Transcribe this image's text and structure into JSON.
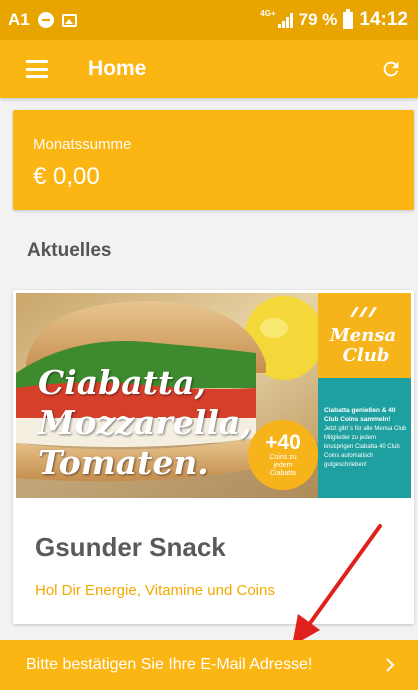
{
  "status_bar": {
    "carrier": "A1",
    "network": "4G+",
    "battery": "79 %",
    "time": "14:12"
  },
  "app_bar": {
    "title": "Home",
    "menu_icon": "hamburger-menu-icon",
    "refresh_icon": "refresh-icon"
  },
  "summary": {
    "label": "Monatssumme",
    "value": "€ 0,00"
  },
  "section": {
    "title": "Aktuelles"
  },
  "news_card": {
    "promo": {
      "headline_lines": [
        "Ciabatta,",
        "Mozzarella,",
        "Tomaten."
      ],
      "coins_value": "+40",
      "coins_caption": "Coins zu jedem Ciabatta",
      "club_logo_text": [
        "Mensa",
        "Club"
      ],
      "side_heading": "Ciabatta genießen & 40 Club Coins sammeln!",
      "side_text": "Jetzt gibt´s für alle Mensa Club Mitglieder zu jedem knusprigen Ciabatta 40 Club Coins automatisch gutgeschrieben!"
    },
    "title": "Gsunder Snack",
    "subtitle": "Hol Dir Energie, Vitamine und Coins"
  },
  "banner": {
    "text": "Bitte bestätigen Sie Ihre E-Mail Adresse!",
    "chevron_icon": "chevron-right-icon"
  },
  "colors": {
    "status_bar": "#e8a500",
    "primary": "#fbb613",
    "accent_text": "#f4a800",
    "teal": "#1fa0a0",
    "annotation": "#e0201c"
  }
}
